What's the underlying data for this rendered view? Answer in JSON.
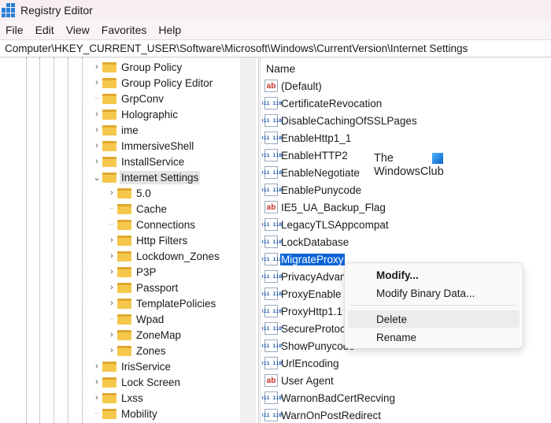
{
  "window": {
    "title": "Registry Editor"
  },
  "menu": [
    "File",
    "Edit",
    "View",
    "Favorites",
    "Help"
  ],
  "address": "Computer\\HKEY_CURRENT_USER\\Software\\Microsoft\\Windows\\CurrentVersion\\Internet Settings",
  "tree": [
    {
      "label": "Group Policy",
      "level": 0,
      "chevron": ">"
    },
    {
      "label": "Group Policy Editor",
      "level": 0,
      "chevron": ">"
    },
    {
      "label": "GrpConv",
      "level": 0,
      "chevron": ""
    },
    {
      "label": "Holographic",
      "level": 0,
      "chevron": ">"
    },
    {
      "label": "ime",
      "level": 0,
      "chevron": ">"
    },
    {
      "label": "ImmersiveShell",
      "level": 0,
      "chevron": ">"
    },
    {
      "label": "InstallService",
      "level": 0,
      "chevron": ">"
    },
    {
      "label": "Internet Settings",
      "level": 0,
      "chevron": "v",
      "selected": true
    },
    {
      "label": "5.0",
      "level": 1,
      "chevron": ">"
    },
    {
      "label": "Cache",
      "level": 1,
      "chevron": ""
    },
    {
      "label": "Connections",
      "level": 1,
      "chevron": ""
    },
    {
      "label": "Http Filters",
      "level": 1,
      "chevron": ">"
    },
    {
      "label": "Lockdown_Zones",
      "level": 1,
      "chevron": ">"
    },
    {
      "label": "P3P",
      "level": 1,
      "chevron": ">"
    },
    {
      "label": "Passport",
      "level": 1,
      "chevron": ">"
    },
    {
      "label": "TemplatePolicies",
      "level": 1,
      "chevron": ">"
    },
    {
      "label": "Wpad",
      "level": 1,
      "chevron": ""
    },
    {
      "label": "ZoneMap",
      "level": 1,
      "chevron": ">"
    },
    {
      "label": "Zones",
      "level": 1,
      "chevron": ">"
    },
    {
      "label": "IrisService",
      "level": 0,
      "chevron": ">"
    },
    {
      "label": "Lock Screen",
      "level": 0,
      "chevron": ">"
    },
    {
      "label": "Lxss",
      "level": 0,
      "chevron": ">"
    },
    {
      "label": "Mobility",
      "level": 0,
      "chevron": ""
    }
  ],
  "list": {
    "header": "Name",
    "values": [
      {
        "name": "(Default)",
        "type": "string"
      },
      {
        "name": "CertificateRevocation",
        "type": "binary"
      },
      {
        "name": "DisableCachingOfSSLPages",
        "type": "binary"
      },
      {
        "name": "EnableHttp1_1",
        "type": "binary"
      },
      {
        "name": "EnableHTTP2",
        "type": "binary"
      },
      {
        "name": "EnableNegotiate",
        "type": "binary"
      },
      {
        "name": "EnablePunycode",
        "type": "binary"
      },
      {
        "name": "IE5_UA_Backup_Flag",
        "type": "string"
      },
      {
        "name": "LegacyTLSAppcompat",
        "type": "binary"
      },
      {
        "name": "LockDatabase",
        "type": "binary"
      },
      {
        "name": "MigrateProxy",
        "type": "binary",
        "selected": true
      },
      {
        "name": "PrivacyAdvanced",
        "type": "binary"
      },
      {
        "name": "ProxyEnable",
        "type": "binary"
      },
      {
        "name": "ProxyHttp1.1",
        "type": "binary"
      },
      {
        "name": "SecureProtocols",
        "type": "binary"
      },
      {
        "name": "ShowPunycode",
        "type": "binary"
      },
      {
        "name": "UrlEncoding",
        "type": "binary"
      },
      {
        "name": "User Agent",
        "type": "string"
      },
      {
        "name": "WarnonBadCertRecving",
        "type": "binary"
      },
      {
        "name": "WarnOnPostRedirect",
        "type": "binary"
      }
    ]
  },
  "context_menu": {
    "modify": "Modify...",
    "modify_binary": "Modify Binary Data...",
    "delete": "Delete",
    "rename": "Rename"
  },
  "watermark": {
    "line1": "The",
    "line2": "WindowsClub"
  },
  "colors": {
    "selection": "#0a64d6",
    "folder": "#f5c84c"
  }
}
